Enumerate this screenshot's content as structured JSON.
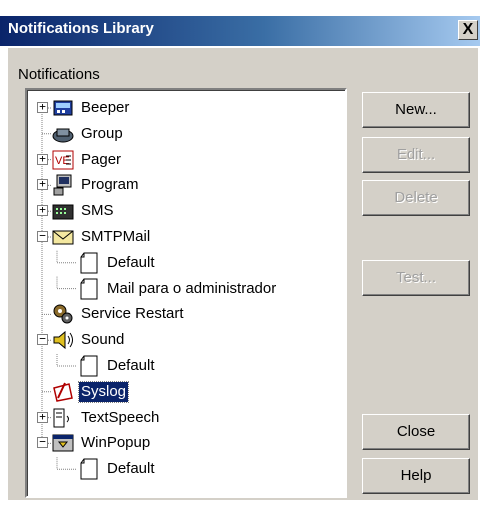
{
  "window": {
    "title": "Notifications Library",
    "close_label": "X"
  },
  "group_label": "Notifications",
  "tree": [
    {
      "label": "Beeper",
      "icon": "beeper-icon",
      "expander": "+",
      "level": 0
    },
    {
      "label": "Group",
      "icon": "group-icon",
      "expander": "",
      "level": 0
    },
    {
      "label": "Pager",
      "icon": "pager-icon",
      "expander": "+",
      "level": 0
    },
    {
      "label": "Program",
      "icon": "program-icon",
      "expander": "+",
      "level": 0
    },
    {
      "label": "SMS",
      "icon": "sms-icon",
      "expander": "+",
      "level": 0
    },
    {
      "label": "SMTPMail",
      "icon": "envelope-icon",
      "expander": "-",
      "level": 0
    },
    {
      "label": "Default",
      "icon": "document-icon",
      "expander": "",
      "level": 1
    },
    {
      "label": "Mail para o administrador",
      "icon": "document-icon",
      "expander": "",
      "level": 1
    },
    {
      "label": "Service Restart",
      "icon": "gears-icon",
      "expander": "",
      "level": 0
    },
    {
      "label": "Sound",
      "icon": "speaker-icon",
      "expander": "-",
      "level": 0
    },
    {
      "label": "Default",
      "icon": "document-icon",
      "expander": "",
      "level": 1
    },
    {
      "label": "Syslog",
      "icon": "syslog-icon",
      "expander": "",
      "level": 0,
      "selected": true
    },
    {
      "label": "TextSpeech",
      "icon": "text-speech-icon",
      "expander": "+",
      "level": 0
    },
    {
      "label": "WinPopup",
      "icon": "popup-icon",
      "expander": "-",
      "level": 0
    },
    {
      "label": "Default",
      "icon": "document-icon",
      "expander": "",
      "level": 1
    }
  ],
  "buttons": {
    "new": {
      "label": "New...",
      "enabled": true
    },
    "edit": {
      "label": "Edit...",
      "enabled": false
    },
    "delete": {
      "label": "Delete",
      "enabled": false
    },
    "test": {
      "label": "Test...",
      "enabled": false
    },
    "close": {
      "label": "Close",
      "enabled": true
    },
    "help": {
      "label": "Help",
      "enabled": true
    }
  },
  "colors": {
    "title_start": "#0a246a",
    "title_end": "#a6caf0",
    "face": "#d4d0c8",
    "selection": "#0a246a"
  }
}
